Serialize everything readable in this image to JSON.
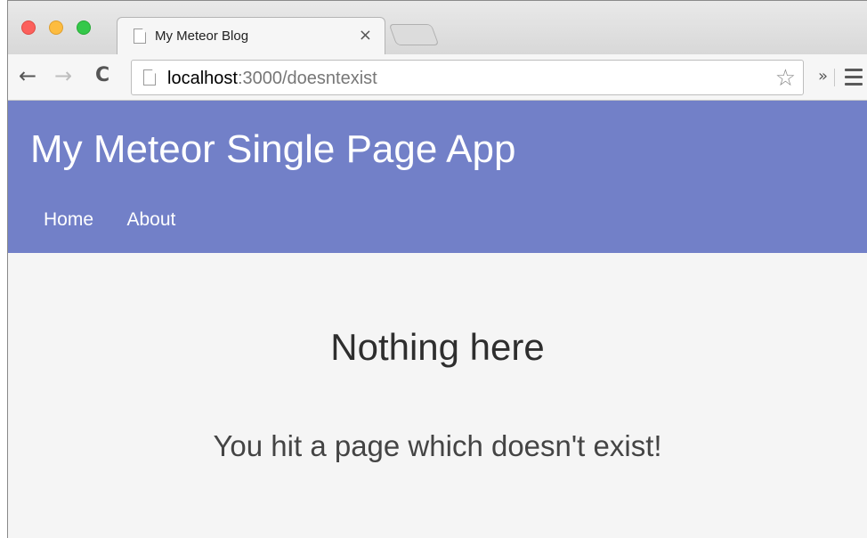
{
  "browser": {
    "tab": {
      "title": "My Meteor Blog",
      "close_glyph": "×"
    },
    "toolbar": {
      "back_glyph": "←",
      "forward_glyph": "→",
      "reload_glyph": "C",
      "url_host": "localhost",
      "url_rest": ":3000/doesntexist",
      "star_glyph": "☆",
      "extensions_glyph": "»"
    }
  },
  "app": {
    "title": "My Meteor Single Page App",
    "nav": [
      {
        "label": "Home"
      },
      {
        "label": "About"
      }
    ],
    "header_color": "#7280c8"
  },
  "content": {
    "heading": "Nothing here",
    "message": "You hit a page which doesn't exist!"
  }
}
